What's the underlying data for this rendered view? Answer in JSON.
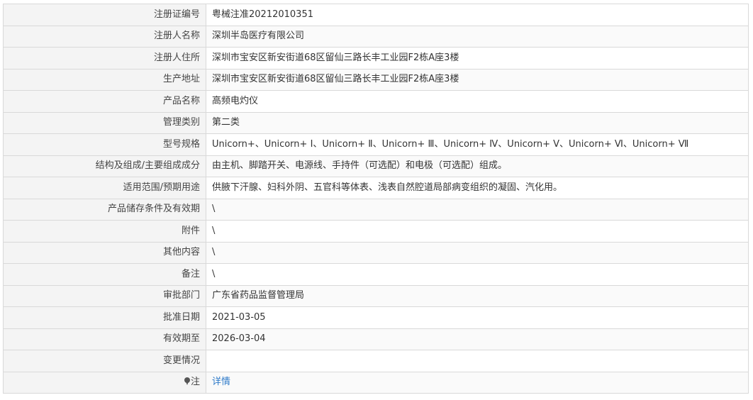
{
  "rows": [
    {
      "label": "注册证编号",
      "value": "粤械注准20212010351"
    },
    {
      "label": "注册人名称",
      "value": "深圳半岛医疗有限公司"
    },
    {
      "label": "注册人住所",
      "value": "深圳市宝安区新安街道68区留仙三路长丰工业园F2栋A座3楼"
    },
    {
      "label": "生产地址",
      "value": "深圳市宝安区新安街道68区留仙三路长丰工业园F2栋A座3楼"
    },
    {
      "label": "产品名称",
      "value": "高频电灼仪"
    },
    {
      "label": "管理类别",
      "value": "第二类"
    },
    {
      "label": "型号规格",
      "value": "Unicorn+、Unicorn+ Ⅰ、Unicorn+ Ⅱ、Unicorn+ Ⅲ、Unicorn+ Ⅳ、Unicorn+ Ⅴ、Unicorn+ Ⅵ、Unicorn+ Ⅶ"
    },
    {
      "label": "结构及组成/主要组成成分",
      "value": "由主机、脚踏开关、电源线、手持件（可选配）和电极（可选配）组成。"
    },
    {
      "label": "适用范围/预期用途",
      "value": "供腋下汗腺、妇科外阴、五官科等体表、浅表自然腔道局部病变组织的凝固、汽化用。"
    },
    {
      "label": "产品储存条件及有效期",
      "value": "\\"
    },
    {
      "label": "附件",
      "value": "\\"
    },
    {
      "label": "其他内容",
      "value": "\\"
    },
    {
      "label": "备注",
      "value": "\\"
    },
    {
      "label": "审批部门",
      "value": "广东省药品监督管理局"
    },
    {
      "label": "批准日期",
      "value": "2021-03-05"
    },
    {
      "label": "有效期至",
      "value": "2026-03-04"
    },
    {
      "label": "变更情况",
      "value": ""
    }
  ],
  "note": {
    "label": "注",
    "link": "详情",
    "icon": "pin-icon"
  }
}
